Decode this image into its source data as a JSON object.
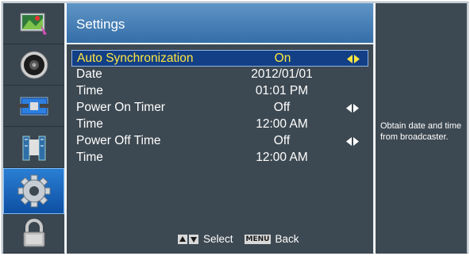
{
  "sidebar": {
    "items": [
      {
        "icon": "picture-icon"
      },
      {
        "icon": "speaker-icon"
      },
      {
        "icon": "channel-satellite-icon"
      },
      {
        "icon": "tv-tower-icon"
      },
      {
        "icon": "gear-icon",
        "active": true
      },
      {
        "icon": "lock-icon"
      }
    ]
  },
  "header": {
    "title": "Settings"
  },
  "rows": [
    {
      "label": "Auto Synchronization",
      "value": "On",
      "arrows": true,
      "selected": true
    },
    {
      "label": "Date",
      "value": "2012/01/01",
      "arrows": false
    },
    {
      "label": "Time",
      "value": "01:01 PM",
      "arrows": false
    },
    {
      "label": "Power On Timer",
      "value": "Off",
      "arrows": true
    },
    {
      "label": "Time",
      "value": "12:00 AM",
      "arrows": false
    },
    {
      "label": "Power Off Time",
      "value": "Off",
      "arrows": true
    },
    {
      "label": "Time",
      "value": "12:00 AM",
      "arrows": false
    }
  ],
  "footer": {
    "select_label": "Select",
    "menu_key": "MENU",
    "back_label": "Back"
  },
  "help": {
    "text": "Obtain date and time from broadcaster."
  },
  "colors": {
    "highlight_text": "#ffe640",
    "selected_row": "#123f85",
    "header": "#4a86bf"
  }
}
